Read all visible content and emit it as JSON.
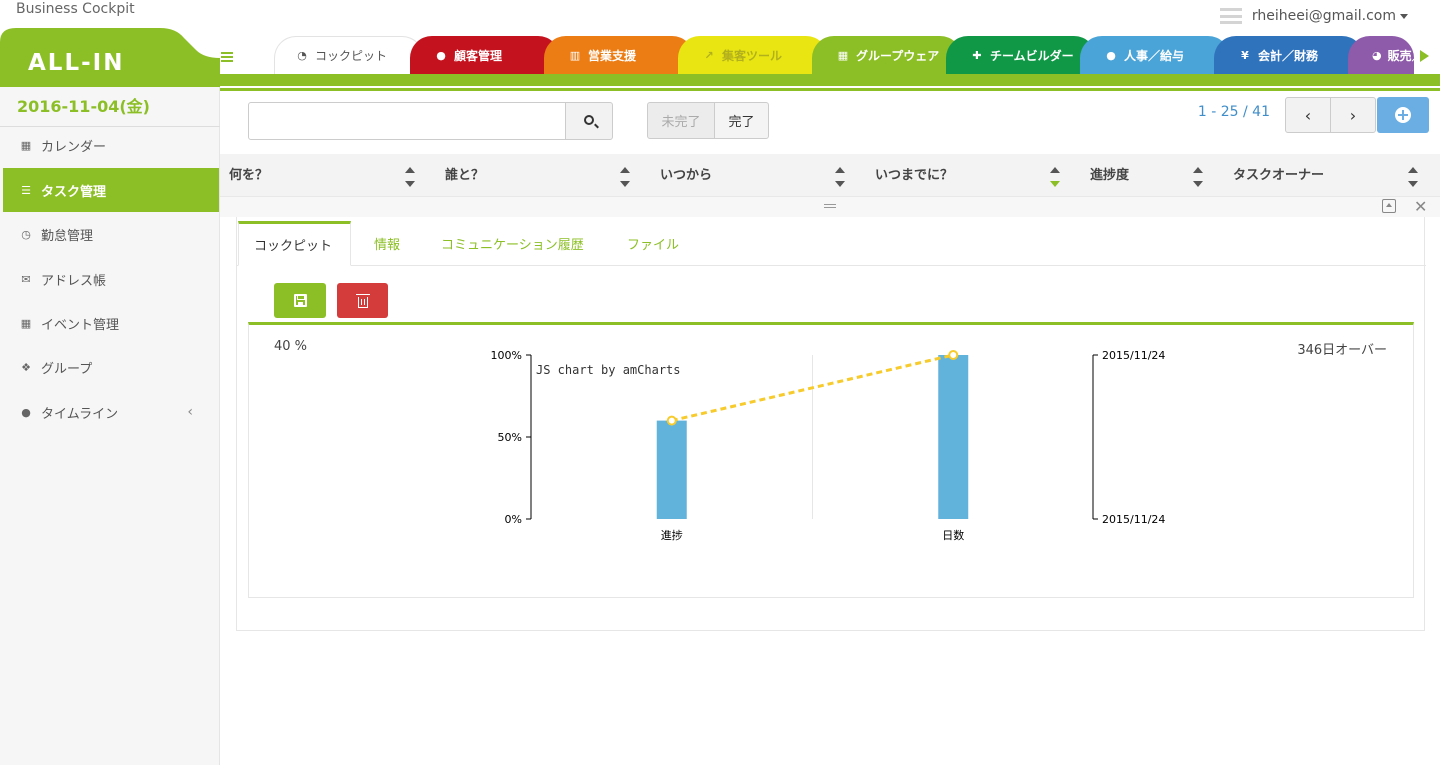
{
  "app": {
    "title": "Business Cockpit",
    "logo": "ALL-IN",
    "user_email": "rheiheei@gmail.com"
  },
  "colors": {
    "brand": "#8cbf26",
    "cockpit": "#ffffff",
    "kokyaku": "#c4121e",
    "eigyo": "#ec7c14",
    "shukyaku": "#e8e512",
    "group": "#8cbf26",
    "team": "#119847",
    "jinji": "#4ba4d7",
    "kaikei": "#2f73bd",
    "hanbai": "#8e5aaa",
    "bar": "#62b3dc",
    "line": "#f7cb2b",
    "delete": "#d43c3c"
  },
  "nav_tabs": [
    {
      "label": "コックピット",
      "icon": "dashboard-icon"
    },
    {
      "label": "顧客管理",
      "icon": "comments-icon"
    },
    {
      "label": "営業支援",
      "icon": "bar-chart-icon"
    },
    {
      "label": "集客ツール",
      "icon": "line-chart-icon"
    },
    {
      "label": "グループウェア",
      "icon": "calendar-icon"
    },
    {
      "label": "チームビルダー",
      "icon": "user-plus-icon"
    },
    {
      "label": "人事／給与",
      "icon": "users-icon"
    },
    {
      "label": "会計／財務",
      "icon": "yen-icon"
    },
    {
      "label": "販売／",
      "icon": "pie-chart-icon"
    }
  ],
  "sidebar": {
    "date": "2016-11-04(金)",
    "items": [
      {
        "label": "カレンダー",
        "icon": "calendar-icon"
      },
      {
        "label": "タスク管理",
        "icon": "tasks-icon"
      },
      {
        "label": "勤怠管理",
        "icon": "clock-icon"
      },
      {
        "label": "アドレス帳",
        "icon": "envelope-icon"
      },
      {
        "label": "イベント管理",
        "icon": "calendar-icon"
      },
      {
        "label": "グループ",
        "icon": "cubes-icon"
      },
      {
        "label": "タイムライン",
        "icon": "comments-icon",
        "chevron": "‹"
      }
    ]
  },
  "search": {
    "placeholder": "",
    "value": ""
  },
  "filters": {
    "incomplete": "未完了",
    "complete": "完了"
  },
  "pager": {
    "text": "1 - 25 / 41",
    "prev": "‹",
    "next": "›"
  },
  "table": {
    "columns": [
      "何を？",
      "誰と？",
      "いつから",
      "いつまでに？",
      "進捗度",
      "タスクオーナー"
    ]
  },
  "detail": {
    "tabs": [
      "コックピット",
      "情報",
      "コミュニケーション履歴",
      "ファイル"
    ]
  },
  "chart_header": {
    "left": "40 %",
    "right": "346日オーバー"
  },
  "chart_data": {
    "type": "bar",
    "watermark": "JS chart by amCharts",
    "categories": [
      "進捗",
      "日数"
    ],
    "series": [
      {
        "type": "bar",
        "values": [
          60,
          100
        ]
      },
      {
        "type": "line",
        "values": [
          60,
          100
        ]
      }
    ],
    "y_left": {
      "ticks": [
        "0%",
        "50%",
        "100%"
      ],
      "ylim": [
        0,
        100
      ]
    },
    "y_right": {
      "ticks": [
        "2015/11/24",
        "2015/11/24"
      ]
    },
    "grid": false
  }
}
